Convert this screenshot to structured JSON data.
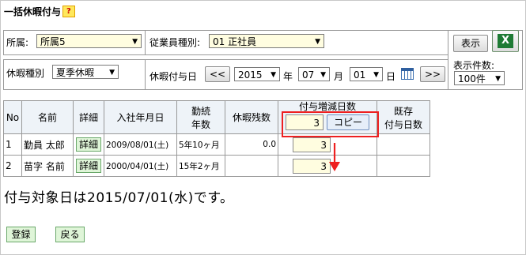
{
  "header": {
    "title": "一括休暇付与",
    "help_label": "?"
  },
  "filters": {
    "dept_label": "所属:",
    "dept_value": "所属5",
    "emp_type_label": "従業員種別:",
    "emp_type_value": "01 正社員",
    "leave_type_label": "休暇種別",
    "leave_type_value": "夏季休暇",
    "grant_date_label": "休暇付与日",
    "prev_label": "<<",
    "year_value": "2015",
    "year_unit": "年",
    "month_value": "07",
    "month_unit": "月",
    "day_value": "01",
    "day_unit": "日",
    "next_label": ">>",
    "display_button": "表示",
    "page_size_label": "表示件数:",
    "page_size_value": "100件"
  },
  "table": {
    "headers": {
      "no": "No",
      "name": "名前",
      "detail": "詳細",
      "hire_date": "入社年月日",
      "tenure_l1": "勤続",
      "tenure_l2": "年数",
      "remaining": "休暇残数",
      "grant_change": "付与増減日数",
      "existing_l1": "既存",
      "existing_l2": "付与日数"
    },
    "copy_value": "3",
    "copy_button": "コピー",
    "rows": [
      {
        "no": "1",
        "name": "勤員 太郎",
        "detail": "詳細",
        "hire_date": "2009/08/01(土)",
        "tenure": "5年10ヶ月",
        "remaining": "0.0",
        "grant": "3",
        "existing": ""
      },
      {
        "no": "2",
        "name": "苗字 名前",
        "detail": "詳細",
        "hire_date": "2000/04/01(土)",
        "tenure": "15年2ヶ月",
        "remaining": "",
        "grant": "3",
        "existing": ""
      }
    ]
  },
  "note": "付与対象日は2015/07/01(水)です。",
  "actions": {
    "register": "登録",
    "back": "戻る"
  },
  "colors": {
    "highlight": "#ee2020",
    "input_bg": "#fffde0",
    "green_button": "#dff5d8",
    "header_bg": "#eef3f8"
  },
  "icons": [
    "help-icon",
    "calendar-icon",
    "excel-icon",
    "arrow-down-icon",
    "chevron-down-icon"
  ]
}
